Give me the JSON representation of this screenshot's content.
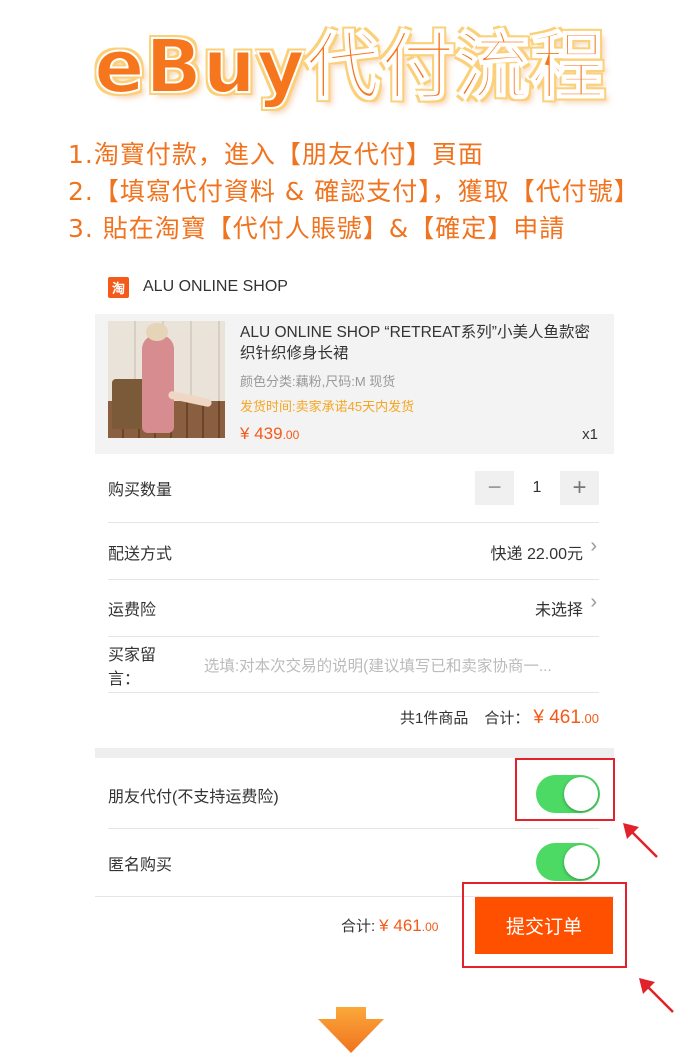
{
  "banner": {
    "title": "eBuy代付流程",
    "steps": [
      "1.淘寶付款，進入【朋友代付】頁面",
      "2.【填寫代付資料 & 確認支付】，獲取【代付號】",
      "3. 貼在淘寶【代付人賬號】&【確定】申請"
    ]
  },
  "shop": {
    "logo_char": "淘",
    "name": "ALU ONLINE SHOP"
  },
  "product": {
    "title": "ALU ONLINE SHOP “RETREAT系列”小美人鱼款密织针织修身长裙",
    "variant": "颜色分类:藕粉,尺码:M 现货",
    "ship_time": "发货时间:卖家承诺45天内发货",
    "price_symbol": "¥",
    "price_int": "439",
    "price_dec": ".00",
    "qty": "x1"
  },
  "order": {
    "quantity_label": "购买数量",
    "quantity_minus": "−",
    "quantity_value": "1",
    "quantity_plus": "+",
    "delivery_label": "配送方式",
    "delivery_value": "快递 22.00元",
    "insurance_label": "运费险",
    "insurance_value": "未选择",
    "note_label": "买家留言：",
    "note_placeholder": "选填:对本次交易的说明(建议填写已和卖家协商一...",
    "summary_count": "共1件商品",
    "summary_total_label": "合计：",
    "summary_price_symbol": "¥",
    "summary_price_int": "461",
    "summary_price_dec": ".00"
  },
  "options": {
    "friend_pay_label": "朋友代付(不支持运费险)",
    "friend_pay_on": true,
    "anonymous_label": "匿名购买",
    "anonymous_on": true
  },
  "footer": {
    "total_label": "合计:",
    "price_symbol": "¥",
    "price_int": "461",
    "price_dec": ".00",
    "submit_label": "提交订单"
  },
  "colors": {
    "accent": "#ff5000",
    "banner_orange": "#f0731f",
    "toggle_green": "#4cd964",
    "highlight_red": "#e2222a"
  }
}
